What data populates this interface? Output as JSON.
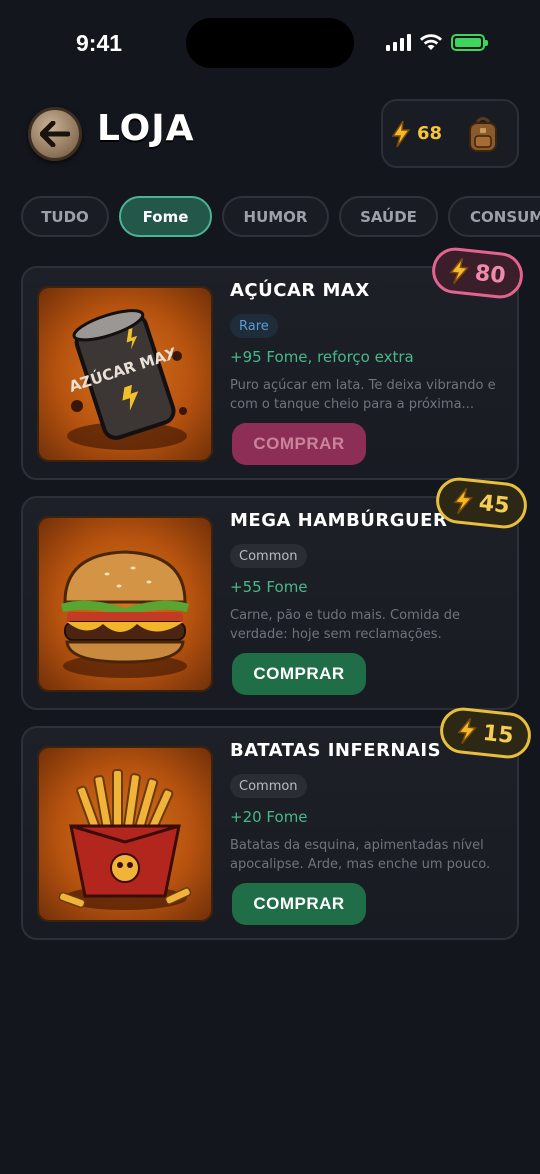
{
  "status_bar": {
    "time": "9:41"
  },
  "header": {
    "title": "LOJA",
    "coins": "68"
  },
  "tabs": [
    {
      "label": "TUDO",
      "active": false
    },
    {
      "label": "Fome",
      "active": true
    },
    {
      "label": "HUMOR",
      "active": false
    },
    {
      "label": "SAÚDE",
      "active": false
    },
    {
      "label": "CONSUM",
      "active": false
    }
  ],
  "items": [
    {
      "title": "AÇÚCAR MAX",
      "rarity": "Rare",
      "effect": "+95 Fome, reforço extra",
      "description": "Puro açúcar em lata. Te deixa vibrando e com o tanque cheio para a próxima...",
      "button": "COMPRAR",
      "price": "80",
      "image_text": "AZÚCAR MAX"
    },
    {
      "title": "MEGA HAMBÚRGUER",
      "rarity": "Common",
      "effect": "+55 Fome",
      "description": "Carne, pão e tudo mais. Comida de verdade: hoje sem reclamações.",
      "button": "COMPRAR",
      "price": "45"
    },
    {
      "title": "BATATAS INFERNAIS",
      "rarity": "Common",
      "effect": "+20 Fome",
      "description": "Batatas da esquina, apimentadas nível apocalipse. Arde, mas enche um pouco.",
      "button": "COMPRAR",
      "price": "15"
    }
  ],
  "colors": {
    "accent_green": "#22574a",
    "price_pink": "#e2648f",
    "price_yellow": "#e7bf3c"
  }
}
